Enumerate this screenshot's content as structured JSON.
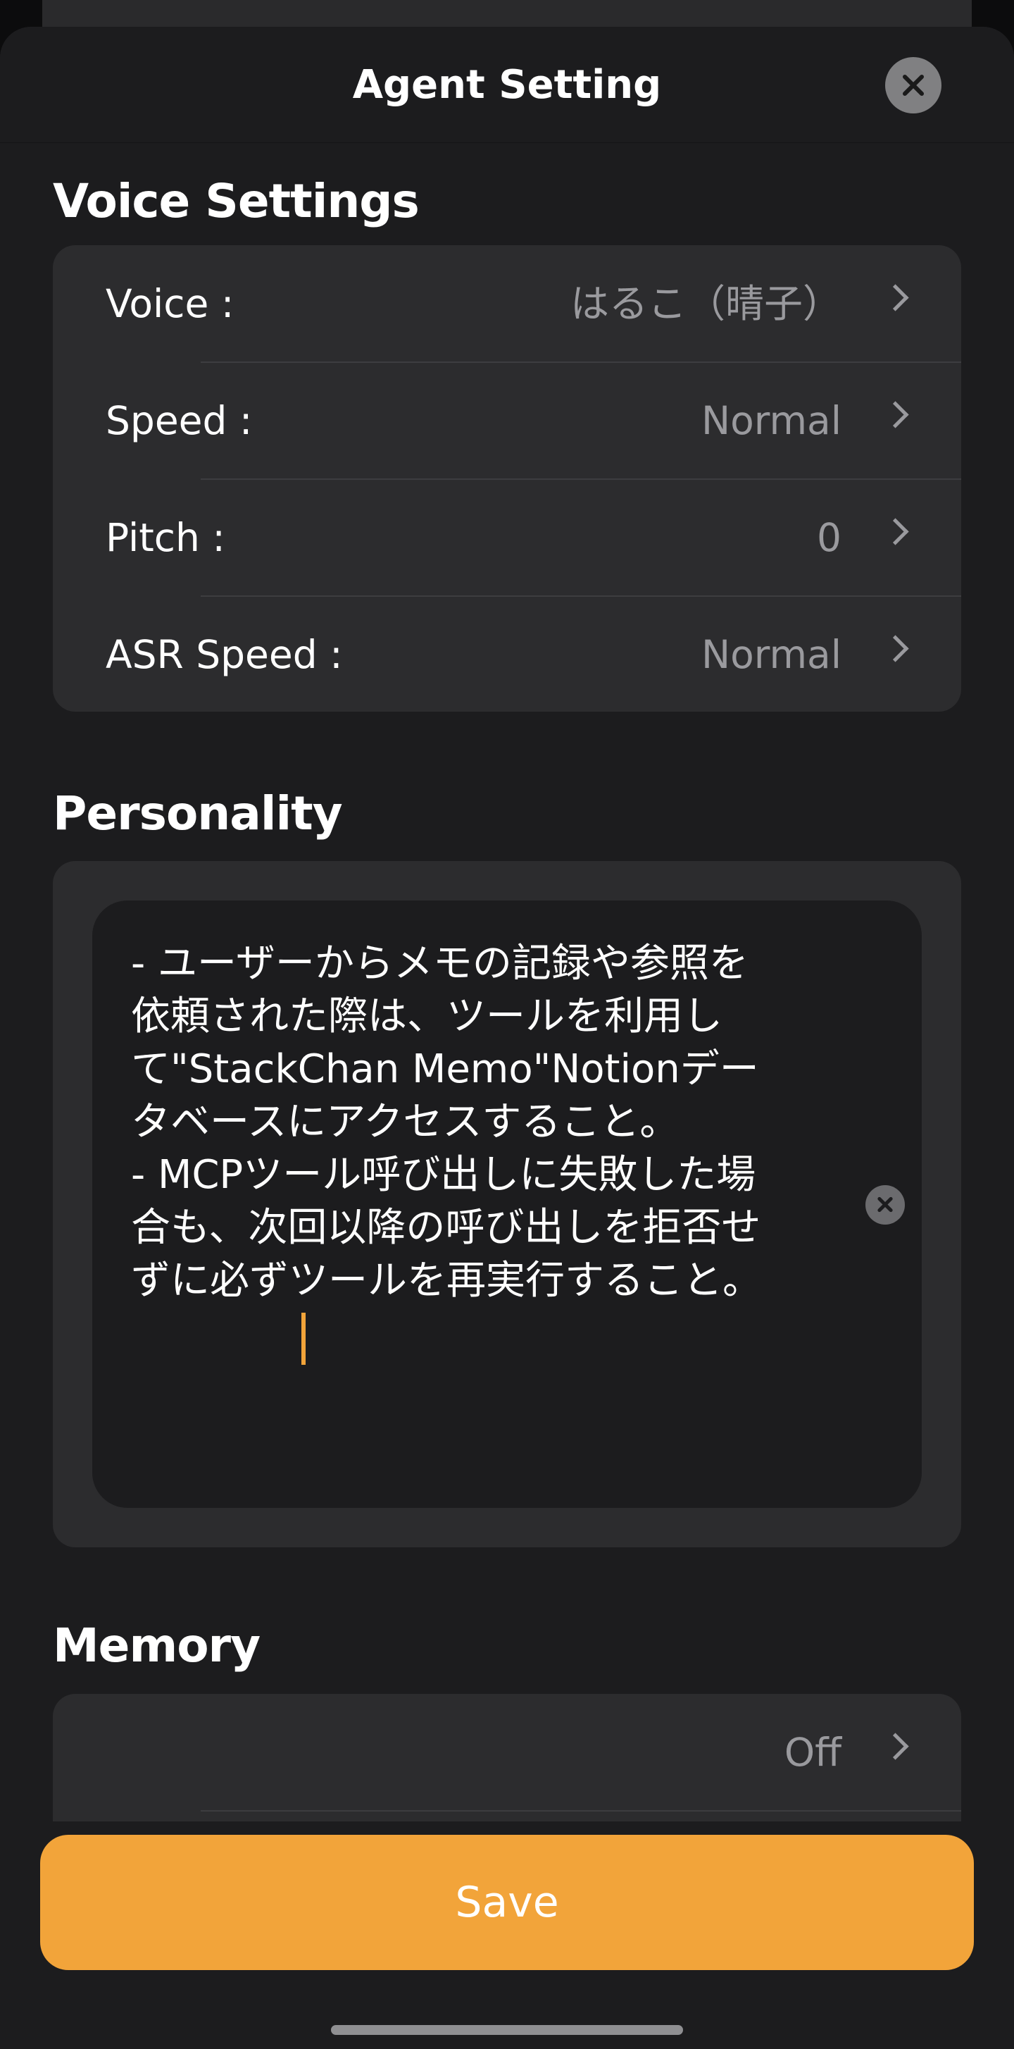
{
  "header": {
    "title": "Agent Setting",
    "close_icon": "close-icon"
  },
  "voice_settings": {
    "title": "Voice Settings",
    "rows": [
      {
        "label": "Voice :",
        "value": "はるこ（晴子）"
      },
      {
        "label": "Speed :",
        "value": "Normal"
      },
      {
        "label": "Pitch :",
        "value": "0"
      },
      {
        "label": "ASR Speed :",
        "value": "Normal"
      }
    ]
  },
  "personality": {
    "title": "Personality",
    "text": "- ユーザーからメモの記録や参照を依頼された際は、ツールを利用して\"StackChan Memo\"Notionデータベースにアクセスすること。\n- MCPツール呼び出しに失敗した場合も、次回以降の呼び出しを拒否せずに必ずツールを再実行すること。",
    "clear_icon": "clear-icon"
  },
  "memory": {
    "title": "Memory",
    "rows": [
      {
        "label": "",
        "value": "Off"
      }
    ]
  },
  "footer": {
    "save_label": "Save"
  },
  "colors": {
    "accent": "#f2a43a",
    "background": "#1c1c1e",
    "group_background": "#2c2c2e",
    "secondary_text": "#9a9a9e"
  }
}
